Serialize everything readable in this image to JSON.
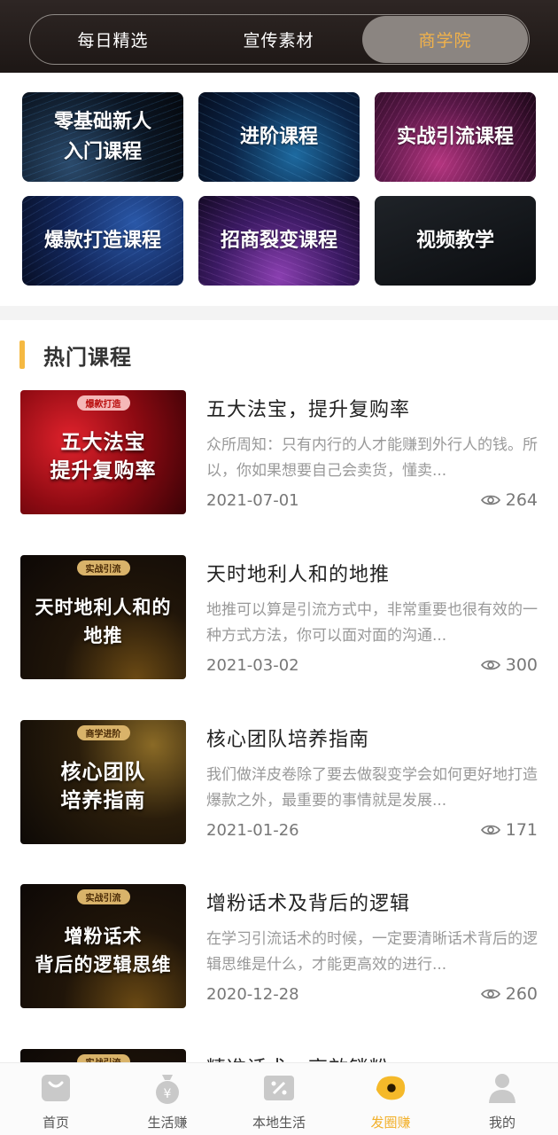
{
  "top_tabs": [
    {
      "label": "每日精选",
      "active": false
    },
    {
      "label": "宣传素材",
      "active": false
    },
    {
      "label": "商学院",
      "active": true
    }
  ],
  "categories": [
    {
      "label_line1": "零基础新人",
      "label_line2": "入门课程"
    },
    {
      "label_line1": "进阶课程",
      "label_line2": ""
    },
    {
      "label_line1": "实战引流课程",
      "label_line2": ""
    },
    {
      "label_line1": "爆款打造课程",
      "label_line2": ""
    },
    {
      "label_line1": "招商裂变课程",
      "label_line2": ""
    },
    {
      "label_line1": "视频教学",
      "label_line2": ""
    }
  ],
  "section": {
    "title": "热门课程"
  },
  "courses": [
    {
      "badge": "爆款打造",
      "thumb_line1": "五大法宝",
      "thumb_line2": "提升复购率",
      "title": "五大法宝，提升复购率",
      "desc": "众所周知：只有内行的人才能赚到外行人的钱。所以，你如果想要自己会卖货，懂卖...",
      "date": "2021-07-01",
      "views": "264"
    },
    {
      "badge": "实战引流",
      "thumb_line1": "天时地利人和的",
      "thumb_line2": "地推",
      "title": "天时地利人和的地推",
      "desc": "地推可以算是引流方式中，非常重要也很有效的一种方式方法，你可以面对面的沟通...",
      "date": "2021-03-02",
      "views": "300"
    },
    {
      "badge": "商学进阶",
      "thumb_line1": "核心团队",
      "thumb_line2": "培养指南",
      "title": "核心团队培养指南",
      "desc": "我们做洋皮卷除了要去做裂变学会如何更好地打造爆款之外，最重要的事情就是发展...",
      "date": "2021-01-26",
      "views": "171"
    },
    {
      "badge": "实战引流",
      "thumb_line1": "增粉话术",
      "thumb_line2": "背后的逻辑思维",
      "title": "增粉话术及背后的逻辑",
      "desc": "在学习引流话术的时候，一定要清晰话术背后的逻辑思维是什么，才能更高效的进行...",
      "date": "2020-12-28",
      "views": "260"
    },
    {
      "badge": "实战引流",
      "thumb_line1": "",
      "thumb_line2": "",
      "title": "精准话术，高效锁粉",
      "desc": "",
      "date": "",
      "views": ""
    }
  ],
  "bottom_nav": [
    {
      "label": "首页",
      "icon": "home-bag-icon",
      "active": false
    },
    {
      "label": "生活赚",
      "icon": "money-bag-icon",
      "active": false
    },
    {
      "label": "本地生活",
      "icon": "coupon-icon",
      "active": false
    },
    {
      "label": "发圈赚",
      "icon": "circle-share-icon",
      "active": true
    },
    {
      "label": "我的",
      "icon": "profile-icon",
      "active": false
    }
  ],
  "colors": {
    "accent": "#f2b24a",
    "header_bg": "#231c1a",
    "muted_text": "#999999"
  }
}
